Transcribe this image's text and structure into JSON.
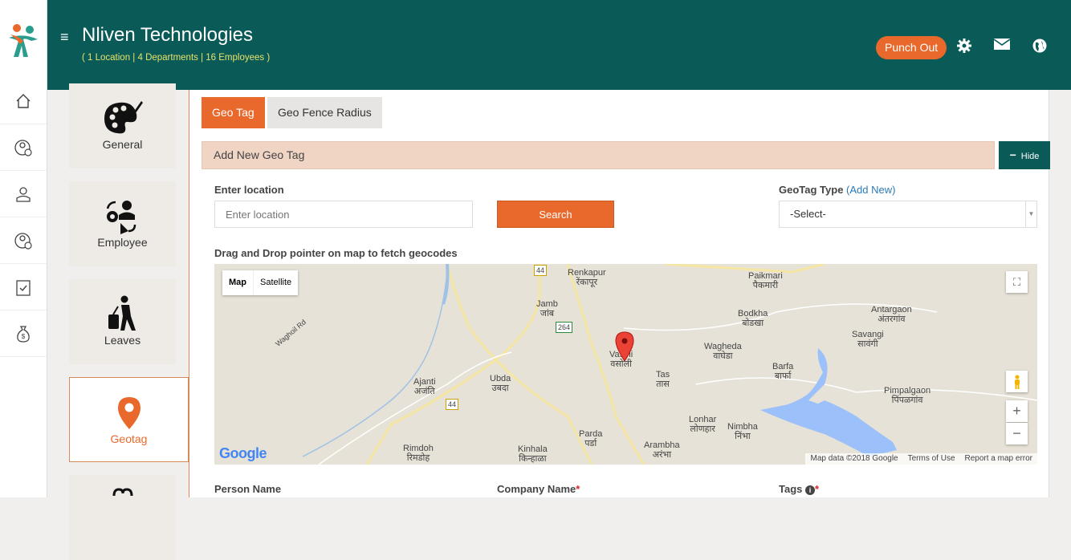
{
  "topbar": {
    "title": "Nliven Technologies",
    "subtitle": "( 1 Location | 4 Departments | 16 Employees )",
    "punch_label": "Punch Out"
  },
  "rail": {
    "items": [
      "home-icon",
      "user-check-icon",
      "employee-icon",
      "user-clock-icon",
      "clipboard-check-icon",
      "money-bag-icon"
    ]
  },
  "secnav": {
    "items": [
      {
        "label": "General",
        "icon": "palette-icon"
      },
      {
        "label": "Employee",
        "icon": "employee-settings-icon"
      },
      {
        "label": "Leaves",
        "icon": "traveler-icon"
      },
      {
        "label": "Geotag",
        "icon": "map-pin-icon",
        "active": true
      }
    ]
  },
  "tabs": {
    "geo_tag": "Geo Tag",
    "geo_fence": "Geo Fence Radius"
  },
  "section": {
    "title": "Add New Geo Tag",
    "hide_label": "Hide"
  },
  "form": {
    "location_label": "Enter location",
    "location_placeholder": "Enter location",
    "search_label": "Search",
    "geotag_type_label": "GeoTag Type",
    "add_new_label": "(Add New)",
    "geotag_type_value": "-Select-",
    "drag_hint": "Drag and Drop pointer on map to fetch geocodes",
    "person_name_label": "Person Name",
    "company_name_label": "Company Name",
    "tags_label": "Tags"
  },
  "map": {
    "map_btn": "Map",
    "satellite_btn": "Satellite",
    "logo": "Google",
    "attribution": [
      "Map data ©2018 Google",
      "Terms of Use",
      "Report a map error"
    ],
    "places": [
      "Renkapur",
      "रेंकापूर",
      "Paikmari",
      "पैकमारी",
      "Jamb",
      "जांब",
      "Bodkha",
      "बोडखा",
      "Antargaon",
      "अंतरगांव",
      "Savangi",
      "सावंगी",
      "Vasoli",
      "वसोली",
      "Wagheda",
      "वाघेडा",
      "Barfa",
      "बार्फा",
      "Tas",
      "तास",
      "Ajanti",
      "अजंति",
      "Ubda",
      "उबदा",
      "Pimpalgaon",
      "पिंपळगांव",
      "Lonhar",
      "लोणहार",
      "Nimbha",
      "निंभा",
      "Parda",
      "पर्डा",
      "Arambha",
      "अरंभा",
      "Kinhala",
      "किन्हाळा",
      "Rimdoh",
      "रिमडोह",
      "Waghoil Rd"
    ],
    "highway_shields": [
      "44",
      "44",
      "264"
    ]
  },
  "colors": {
    "primary": "#0a5a58",
    "accent": "#e8692b"
  }
}
